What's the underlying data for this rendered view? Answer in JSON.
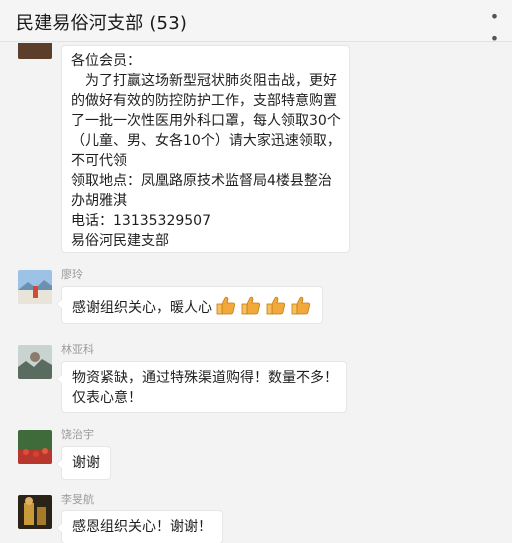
{
  "header": {
    "title": "民建易俗河支部 (53)",
    "more_label": "• •"
  },
  "messages": [
    {
      "lines": [
        "各位会员：",
        "　为了打赢这场新型冠状肺炎阻击战，更好",
        "的做好有效的防控防护工作，支部特意购置",
        "了一批一次性医用外科口罩，每人领取30个",
        "（儿童、男、女各10个）请大家迅速领取，",
        "不可代领",
        "领取地点：凤凰路原技术监督局4楼县整治",
        "办胡雅淇",
        "电话：13135329507",
        "易俗河民建支部"
      ]
    },
    {
      "sender": "廖玲",
      "text": "感谢组织关心，暖人心",
      "emoji": [
        "thumbs-up",
        "thumbs-up",
        "thumbs-up",
        "thumbs-up"
      ]
    },
    {
      "sender": "林亚科",
      "lines": [
        "物资紧缺，通过特殊渠道购得！数量不多！",
        "仅表心意！"
      ]
    },
    {
      "sender": "饶治宇",
      "text": "谢谢"
    },
    {
      "sender": "李旻航",
      "text": "感恩组织关心！谢谢！"
    }
  ],
  "colors": {
    "background": "#f3f3f3",
    "bubble": "#ffffff",
    "sender_name": "#9a9a9a",
    "thumb": "#f2a93b"
  }
}
